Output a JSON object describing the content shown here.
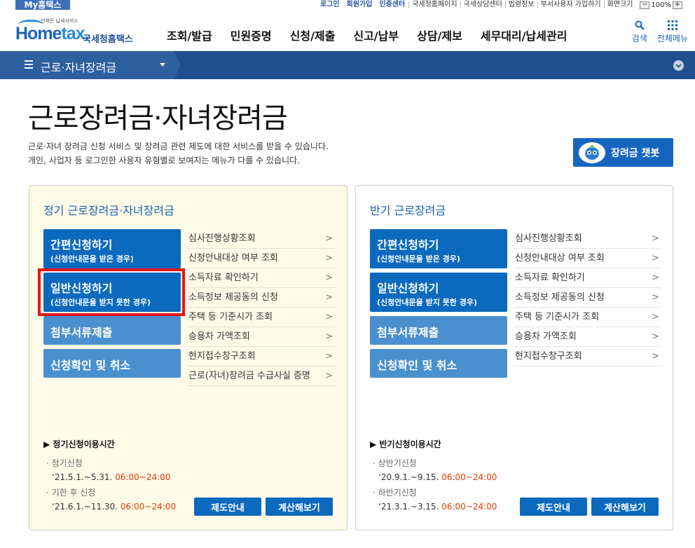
{
  "top": {
    "mytax": "My홈택스",
    "links": [
      "로그인",
      "회원가입",
      "인증센터",
      "국세청홈페이지",
      "국세상담센터",
      "법령정보",
      "부서사용자 가입하기",
      "화면크기"
    ],
    "zoom_minus": "−",
    "zoom_value": "100%",
    "zoom_plus": "+"
  },
  "header": {
    "logo_small": "언제든 납세서비스",
    "logo_home": "Home",
    "logo_tax": "tax.",
    "logo_kr": "국세청홈택스",
    "nav": [
      "조회/발급",
      "민원증명",
      "신청/제출",
      "신고/납부",
      "상담/제보",
      "세무대리/납세관리"
    ],
    "search_label": "검색",
    "allmenu_label": "전체메뉴"
  },
  "subnav": {
    "title": "근로·자녀장려금"
  },
  "page": {
    "title": "근로장려금·자녀장려금",
    "desc1": "근로·자녀 장려금 신청 서비스 및 장려금 관련 제도에 대한 서비스를 받을 수 있습니다.",
    "desc2": "개인, 사업자 등 로그인한 사용자 유형별로 보여지는 메뉴가 다를 수 있습니다.",
    "chatbot": "장려금 챗봇"
  },
  "panel1": {
    "title": "정기 근로장려금·자녀장려금",
    "btn_simple": "간편신청하기",
    "btn_simple_sub": "(신청안내문을 받은 경우)",
    "btn_general": "일반신청하기",
    "btn_general_sub": "(신청안내문을 받지 못한 경우)",
    "btn_docs": "첨부서류제출",
    "btn_confirm": "신청확인 및 취소",
    "links": [
      "심사진행상황조회",
      "신청안내대상 여부 조회",
      "소득자료 확인하기",
      "소득정보 제공동의 신청",
      "주택 등 기준시가 조회",
      "승용차 가액조회",
      "현지접수창구조회",
      "근로(자녀)장려금 수급사실 증명"
    ],
    "time_heading": "▶ 정기신청이용시간",
    "t1_label": "정기신청",
    "t1_date": "‘21.5.1.~5.31.",
    "t1_time": "06:00~24:00",
    "t2_label": "기한 후 신청",
    "t2_date": "‘21.6.1.~11.30.",
    "t2_time": "06:00~24:00",
    "btn_guide": "제도안내",
    "btn_calc": "계산해보기"
  },
  "panel2": {
    "title": "반기 근로장려금",
    "btn_simple": "간편신청하기",
    "btn_simple_sub": "(신청안내문을 받은 경우)",
    "btn_general": "일반신청하기",
    "btn_general_sub": "(신청안내문을 받지 못한 경우)",
    "btn_docs": "첨부서류제출",
    "btn_confirm": "신청확인 및 취소",
    "links": [
      "심사진행상황조회",
      "신청안내대상 여부 조회",
      "소득자료 확인하기",
      "소득정보 제공동의 신청",
      "주택 등 기준시가 조회",
      "승용차 가액조회",
      "현지접수창구조회"
    ],
    "time_heading": "▶ 반기신청이용시간",
    "t1_label": "상반기신청",
    "t1_date": "‘20.9.1.~9.15.",
    "t1_time": "06:00~24:00",
    "t2_label": "하반기신청",
    "t2_date": "‘21.3.1.~3.15.",
    "t2_time": "06:00~24:00",
    "btn_guide": "제도안내",
    "btn_calc": "계산해보기"
  },
  "colors": {
    "primary": "#0b6abe",
    "nav": "#1f4f8f",
    "highlight": "#e8161b",
    "time": "#e33b00",
    "panel_bg": "#fefbe9"
  }
}
